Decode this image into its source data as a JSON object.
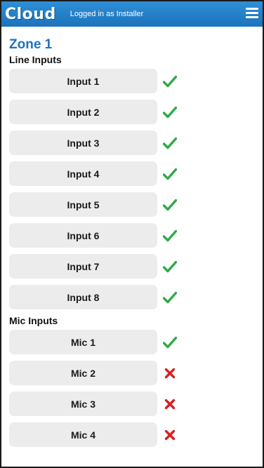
{
  "header": {
    "logo": "Cloud",
    "login_status": "Logged in as Installer",
    "menu_icon": "hamburger-menu-icon"
  },
  "zone": {
    "title": "Zone 1"
  },
  "line_inputs": {
    "title": "Line Inputs",
    "items": [
      {
        "label": "Input 1",
        "status": "enabled",
        "icon": "check-icon"
      },
      {
        "label": "Input 2",
        "status": "enabled",
        "icon": "check-icon"
      },
      {
        "label": "Input 3",
        "status": "enabled",
        "icon": "check-icon"
      },
      {
        "label": "Input 4",
        "status": "enabled",
        "icon": "check-icon"
      },
      {
        "label": "Input 5",
        "status": "enabled",
        "icon": "check-icon"
      },
      {
        "label": "Input 6",
        "status": "enabled",
        "icon": "check-icon"
      },
      {
        "label": "Input 7",
        "status": "enabled",
        "icon": "check-icon"
      },
      {
        "label": "Input 8",
        "status": "enabled",
        "icon": "check-icon"
      }
    ]
  },
  "mic_inputs": {
    "title": "Mic Inputs",
    "items": [
      {
        "label": "Mic 1",
        "status": "enabled",
        "icon": "check-icon"
      },
      {
        "label": "Mic 2",
        "status": "disabled",
        "icon": "cross-icon"
      },
      {
        "label": "Mic 3",
        "status": "disabled",
        "icon": "cross-icon"
      },
      {
        "label": "Mic 4",
        "status": "disabled",
        "icon": "cross-icon"
      }
    ]
  },
  "colors": {
    "header": "#1b73bd",
    "zone_title": "#1b73bd",
    "check": "#2eaa46",
    "cross": "#d82020",
    "button_bg": "#ececec"
  }
}
